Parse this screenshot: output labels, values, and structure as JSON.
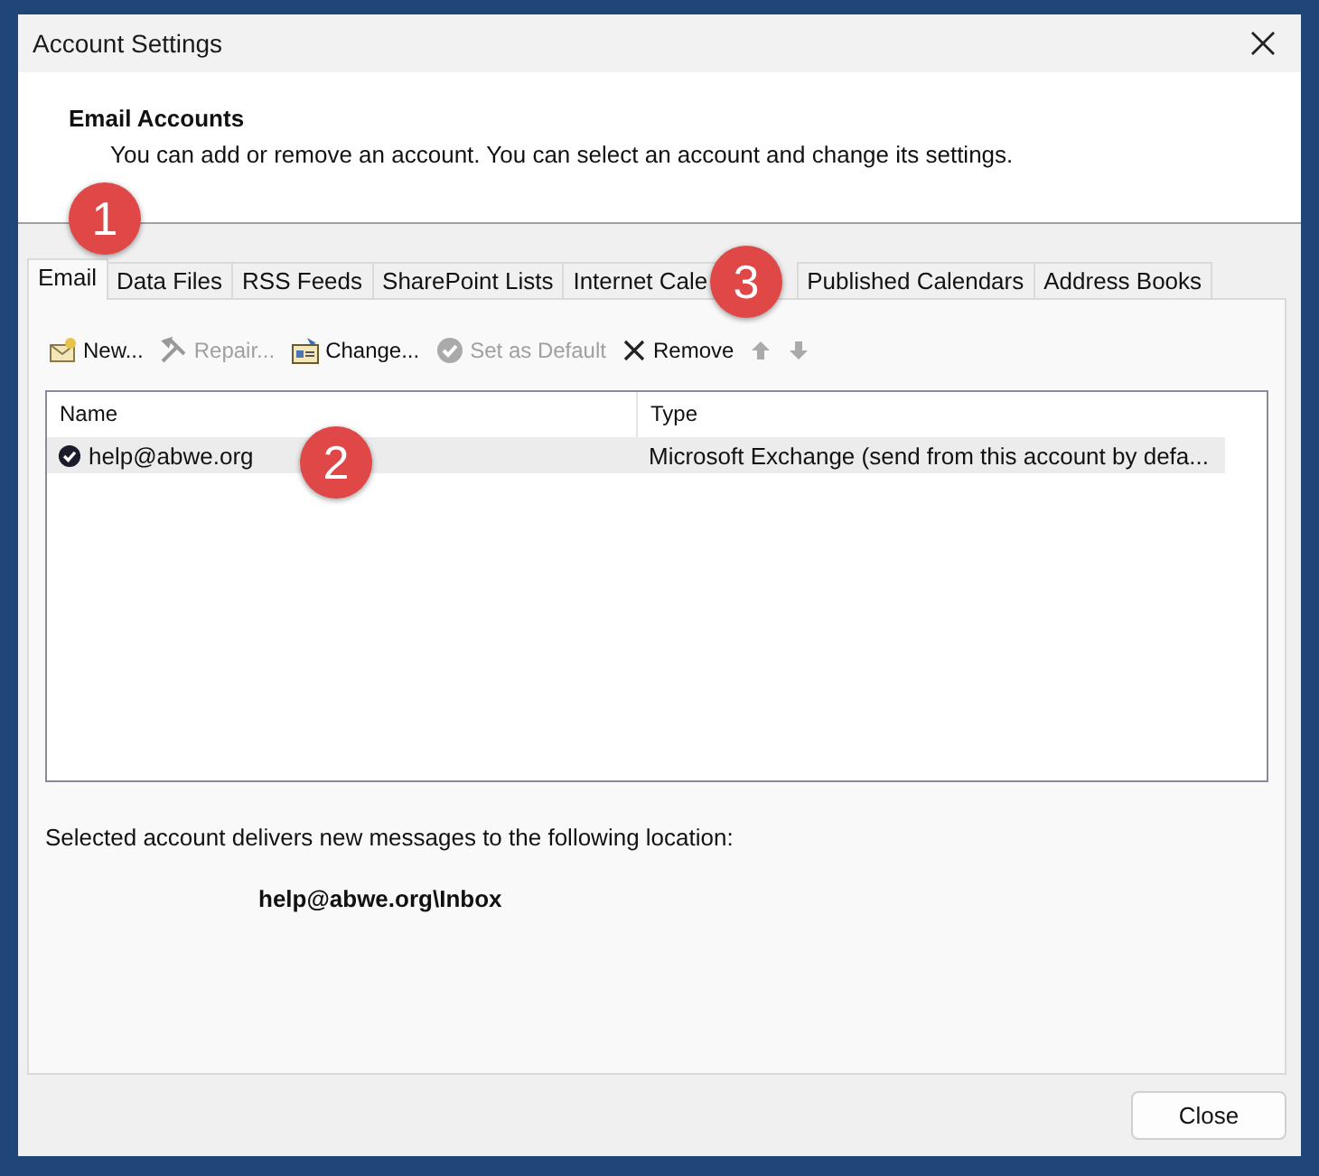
{
  "window": {
    "title": "Account Settings"
  },
  "header": {
    "title": "Email Accounts",
    "description": "You can add or remove an account. You can select an account and change its settings."
  },
  "tabs": [
    {
      "label": "Email",
      "selected": true
    },
    {
      "label": "Data Files",
      "selected": false
    },
    {
      "label": "RSS Feeds",
      "selected": false
    },
    {
      "label": "SharePoint Lists",
      "selected": false
    },
    {
      "label": "Internet Cale",
      "selected": false
    },
    {
      "label": "Published Calendars",
      "selected": false
    },
    {
      "label": "Address Books",
      "selected": false
    }
  ],
  "toolbar": [
    {
      "kind": "new",
      "label": "New...",
      "disabled": false
    },
    {
      "kind": "repair",
      "label": "Repair...",
      "disabled": true
    },
    {
      "kind": "change",
      "label": "Change...",
      "disabled": false
    },
    {
      "kind": "default",
      "label": "Set as Default",
      "disabled": true
    },
    {
      "kind": "remove",
      "label": "Remove",
      "disabled": false
    },
    {
      "kind": "up",
      "disabled": true
    },
    {
      "kind": "down",
      "disabled": true
    }
  ],
  "table": {
    "columns": [
      "Name",
      "Type"
    ],
    "rows": [
      {
        "name": "help@abwe.org",
        "type": "Microsoft Exchange (send from this account by defa...",
        "selected": true,
        "default": true
      }
    ]
  },
  "delivery": {
    "label": "Selected account delivers new messages to the following location:",
    "location": "help@abwe.org\\Inbox"
  },
  "buttons": [
    "Close"
  ],
  "callouts": [
    {
      "label": "1",
      "kind": "tabs"
    },
    {
      "label": "2",
      "kind": "row"
    },
    {
      "label": "3",
      "kind": "tab"
    }
  ]
}
